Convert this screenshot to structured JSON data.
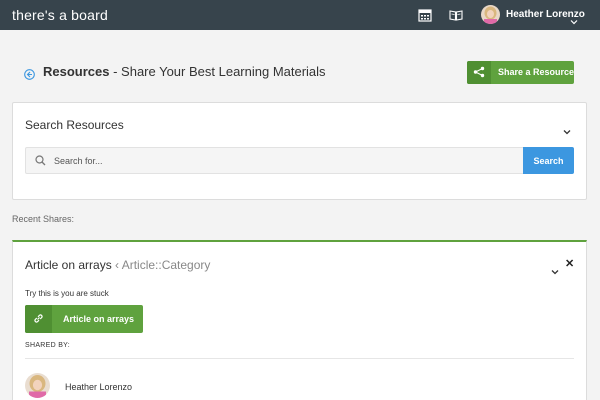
{
  "topbar": {
    "brand": "there's a board",
    "icons": [
      "calendar-icon",
      "book-icon"
    ],
    "user_name": "Heather Lorenzo"
  },
  "header": {
    "title_bold": "Resources",
    "title_rest": " - Share Your Best Learning Materials",
    "share_button_label": "Share a Resource"
  },
  "search": {
    "panel_title": "Search Resources",
    "placeholder": "Search for...",
    "value": "",
    "button_label": "Search"
  },
  "recent": {
    "label": "Recent Shares:",
    "items": [
      {
        "title": "Article on arrays",
        "category": " ‹ Article::Category",
        "description": "Try this is you are stuck",
        "link_label": "Article on arrays",
        "shared_by_label": "SHARED BY:",
        "sharer_name": "Heather Lorenzo"
      }
    ]
  },
  "colors": {
    "topbar": "#37444c",
    "accent_green": "#5fa23e",
    "accent_blue": "#3c97e0"
  }
}
